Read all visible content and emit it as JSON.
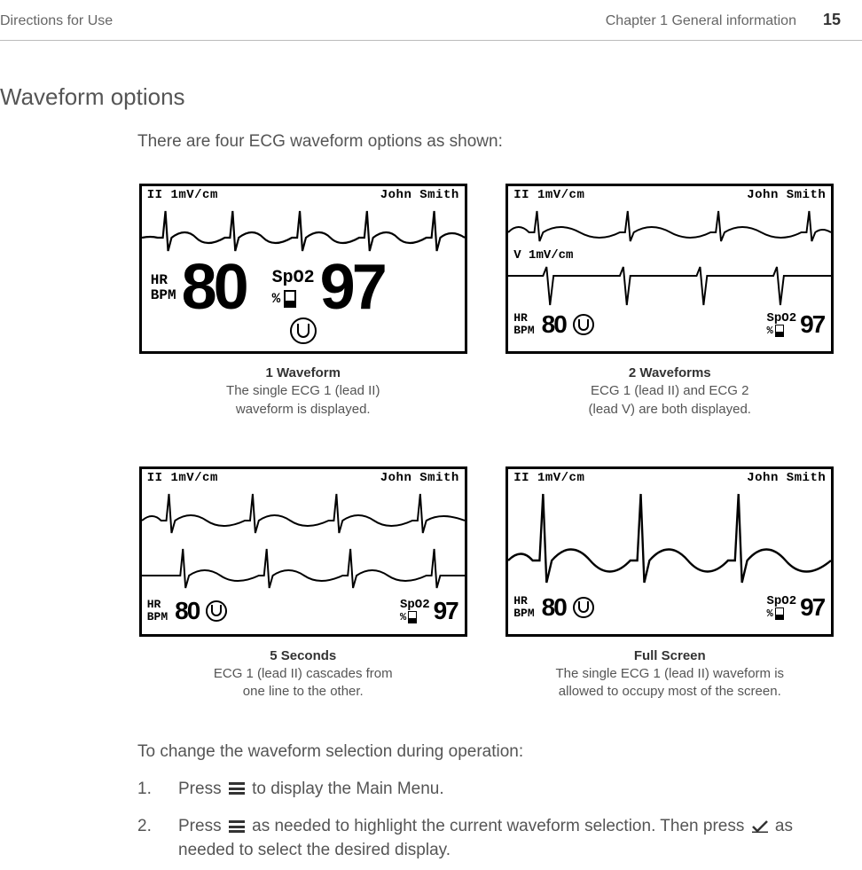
{
  "header": {
    "left": "Directions for Use",
    "chapter": "Chapter 1   General information",
    "page": "15"
  },
  "section_title": "Waveform options",
  "intro": "There are four ECG waveform options as shown:",
  "screen": {
    "lead": "II 1mV/cm",
    "leadV": "V 1mV/cm",
    "patient": "John Smith",
    "hr_lbl1": "HR",
    "hr_lbl2": "BPM",
    "hr_val": "80",
    "sp_lbl": "SpO2",
    "pct": "%",
    "sp_val": "97"
  },
  "panels": {
    "p1": {
      "title": "1 Waveform",
      "desc1": "The single ECG 1 (lead II)",
      "desc2": "waveform is displayed."
    },
    "p2": {
      "title": "2 Waveforms",
      "desc1": "ECG 1 (lead II) and ECG 2",
      "desc2": "(lead V) are both displayed."
    },
    "p3": {
      "title": "5 Seconds",
      "desc1": "ECG 1 (lead II) cascades from",
      "desc2": "one line to the other."
    },
    "p4": {
      "title": "Full Screen",
      "desc1": "The single ECG 1 (lead II) waveform is",
      "desc2": "allowed to occupy most of the screen."
    }
  },
  "change_intro": "To change the waveform selection during operation:",
  "step1": {
    "n": "1.",
    "a": "Press ",
    "b": " to display the Main Menu."
  },
  "step2": {
    "n": "2.",
    "a": "Press ",
    "b": " as needed to highlight the current waveform selection. Then press ",
    "c": " as needed to select the desired display."
  }
}
